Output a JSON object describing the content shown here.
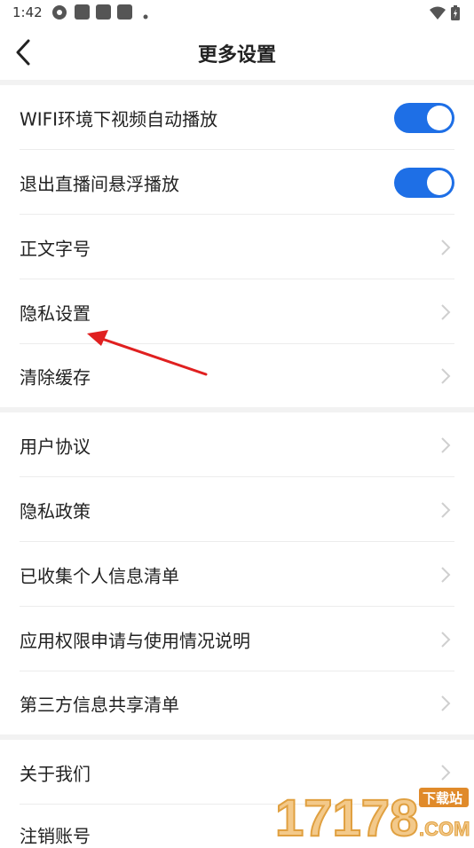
{
  "status_bar": {
    "time": "1:42"
  },
  "header": {
    "title": "更多设置"
  },
  "sections": [
    {
      "rows": [
        {
          "label": "WIFI环境下视频自动播放",
          "control": "toggle",
          "enabled": true
        },
        {
          "label": "退出直播间悬浮播放",
          "control": "toggle",
          "enabled": true
        },
        {
          "label": "正文字号",
          "control": "chevron"
        },
        {
          "label": "隐私设置",
          "control": "chevron"
        },
        {
          "label": "清除缓存",
          "control": "chevron"
        }
      ]
    },
    {
      "rows": [
        {
          "label": "用户协议",
          "control": "chevron"
        },
        {
          "label": "隐私政策",
          "control": "chevron"
        },
        {
          "label": "已收集个人信息清单",
          "control": "chevron"
        },
        {
          "label": "应用权限申请与使用情况说明",
          "control": "chevron"
        },
        {
          "label": "第三方信息共享清单",
          "control": "chevron"
        }
      ]
    },
    {
      "rows": [
        {
          "label": "关于我们",
          "control": "chevron"
        },
        {
          "label": "注销账号",
          "control": "chevron"
        }
      ]
    }
  ],
  "watermark": {
    "text": "17178",
    "badge": "下载站",
    "suffix": ".COM"
  },
  "colors": {
    "accent": "#1e6fe6",
    "annotation": "#e02020",
    "section_gap": "#f2f2f2"
  }
}
